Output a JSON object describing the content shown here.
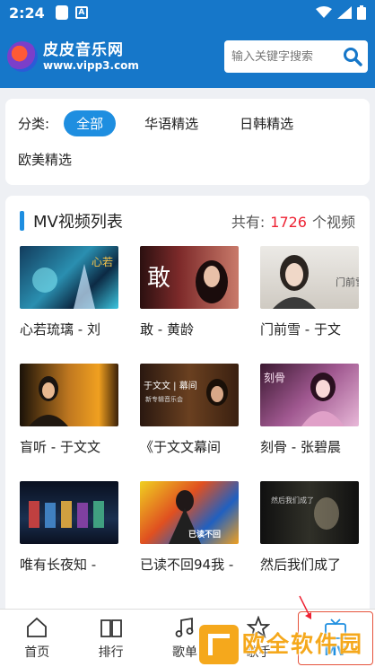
{
  "status_bar": {
    "time": "2:24",
    "app_letter": "A"
  },
  "header": {
    "site_name": "皮皮音乐网",
    "site_url": "www.vipp3.com",
    "search_placeholder": "输入关键字搜索"
  },
  "categories": {
    "label": "分类:",
    "items": [
      {
        "label": "全部",
        "active": true
      },
      {
        "label": "华语精选",
        "active": false
      },
      {
        "label": "日韩精选",
        "active": false
      },
      {
        "label": "欧美精选",
        "active": false
      }
    ]
  },
  "mv_list": {
    "title": "MV视频列表",
    "count_prefix": "共有:",
    "count": "1726",
    "count_suffix": "个视频",
    "items": [
      {
        "title": "心若琉璃 - 刘"
      },
      {
        "title": "敢 - 黄龄"
      },
      {
        "title": "门前雪 - 于文"
      },
      {
        "title": "盲听 - 于文文"
      },
      {
        "title": "《于文文幕间"
      },
      {
        "title": "刻骨 - 张碧晨"
      },
      {
        "title": "唯有长夜知 -"
      },
      {
        "title": "已读不回94我 -"
      },
      {
        "title": "然后我们成了"
      }
    ]
  },
  "bottom_nav": {
    "items": [
      {
        "label": "首页",
        "icon": "home-icon"
      },
      {
        "label": "排行",
        "icon": "book-icon"
      },
      {
        "label": "歌单",
        "icon": "music-note-icon"
      },
      {
        "label": "歌手",
        "icon": "star-icon"
      },
      {
        "label": "MV",
        "icon": "tv-icon"
      }
    ]
  },
  "watermark": {
    "text": "欧全软件园"
  },
  "colors": {
    "primary": "#1677c9",
    "accent": "#1e8ee0",
    "count": "#e23",
    "watermark": "#f5a81c"
  }
}
